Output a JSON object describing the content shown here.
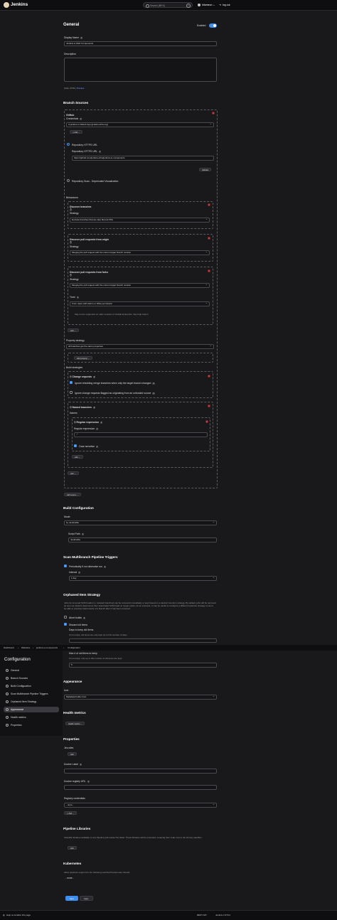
{
  "app": {
    "name": "Jenkins"
  },
  "header": {
    "search_placeholder": "Search (⌘+K)",
    "help": "?",
    "user": "hitomeun",
    "logout": "log out"
  },
  "general": {
    "title": "General",
    "enabled_label": "Enabled",
    "display_name_label": "Display Name",
    "display_name_value": "Jenkins.io Web Components",
    "description_label": "Description",
    "description_value": "",
    "format_note": "[Safe HTML]",
    "preview_link": "Preview"
  },
  "branch_sources": {
    "title": "Branch Sources",
    "github_label": "GitHub",
    "credentials_label": "Credentials",
    "credentials_value": "ci.jenkins.io GitHub App (jenkins-infra org)",
    "add_button": "Add",
    "repo_https_label": "Repository HTTPS URL",
    "repo_https_field_label": "Repository HTTPS URL",
    "repo_url_value": "https://github.com/jenkins-infra/jenkins-io-components",
    "validate_button": "Validate",
    "repo_scan_label": "Repository Scan - Deprecated Visualization",
    "behaviours_label": "Behaviours",
    "discover_branches": {
      "title": "Discover branches",
      "strategy_label": "Strategy",
      "strategy_value": "Exclude branches that are also filed as PRs"
    },
    "discover_prs_origin": {
      "title": "Discover pull requests from origin",
      "strategy_label": "Strategy",
      "strategy_value": "Merging the pull request with the current target branch revision"
    },
    "discover_prs_forks": {
      "title": "Discover pull requests from forks",
      "strategy_label": "Strategy",
      "strategy_value": "Merging the pull request with the current target branch revision",
      "trust_label": "Trust",
      "trust_value": "From users with Admin or Write permission",
      "trust_note": "May not be supported on older versions of GitHub Enterprise. See help button."
    },
    "add_behaviour_button": "Add",
    "property_strategy_label": "Property strategy",
    "property_strategy_value": "All branches get the same properties",
    "add_property_button": "Add property",
    "build_strategies_label": "Build strategies",
    "change_requests": {
      "title": "Change requests",
      "opt1": "Ignore rebuilding merge branches when only the target branch changed",
      "opt2": "Ignore change requests flagged as originating from an untrusted source"
    },
    "named_branches": {
      "title": "Named branches",
      "names_label": "Names",
      "regex_title": "Regular expression",
      "regex_label": "Regular expression",
      "regex_value": ".*",
      "case_sensitive": "Case sensitive",
      "add_inner": "Add",
      "add_outer": "Add"
    },
    "add_strategy_button": "Add",
    "add_source_button": "Add source"
  },
  "build_configuration": {
    "title": "Build Configuration",
    "mode_label": "Mode",
    "mode_value": "by Jenkinsfile",
    "script_path_label": "Script Path",
    "script_path_value": "Jenkinsfile"
  },
  "scan_triggers": {
    "title": "Scan Multibranch Pipeline Triggers",
    "periodic_label": "Periodically if not otherwise run",
    "interval_label": "Interval",
    "interval_value": "1 day"
  },
  "orphaned": {
    "title": "Orphaned Item Strategy",
    "description": "Jobs for removed SCM heads (i.e. deleted branches) can be removed immediately or kept based on a desired retention strategy. By default, jobs will be removed as soon as Jenkins determines their associated SCM head no longer exists. As an example, it may be useful to configure a different retention strategy so as to be able to examine build results of a branch after it has been removed.",
    "abort_builds": "Abort builds",
    "discard_old": "Discard old items",
    "days_label": "Days to keep old items",
    "days_hint": "If not empty, old items are only kept up to this number of days",
    "max_label": "Max # of old items to keep",
    "max_hint": "If not empty, only up to this number of old items are kept",
    "max_value": "5"
  },
  "breadcrumbs": [
    "Dashboard",
    "Websites",
    "jenkins-io-components",
    "Configuration"
  ],
  "sidebar": {
    "title": "Configuration",
    "items": [
      {
        "label": "General",
        "icon": "gear-icon"
      },
      {
        "label": "Branch Sources",
        "icon": "branch-icon"
      },
      {
        "label": "Build Configuration",
        "icon": "build-icon"
      },
      {
        "label": "Scan Multibranch Pipeline Triggers",
        "icon": "clock-icon"
      },
      {
        "label": "Orphaned Item Strategy",
        "icon": "trash-icon"
      },
      {
        "label": "Appearance",
        "icon": "eye-icon"
      },
      {
        "label": "Health metrics",
        "icon": "heart-icon"
      },
      {
        "label": "Properties",
        "icon": "list-icon"
      }
    ],
    "active_index": 5
  },
  "appearance": {
    "title": "Appearance",
    "icon_label": "Icon",
    "icon_value": "Metadata Folder Icon"
  },
  "health": {
    "title": "Health metrics",
    "button": "Health metrics ⌄"
  },
  "properties": {
    "title": "Properties",
    "jira_label": "Jira sites",
    "jira_add": "Add",
    "docker_label_label": "Docker Label",
    "docker_registry_label": "Docker registry URL",
    "registry_credentials_label": "Registry credentials",
    "registry_credentials_value": "- none -",
    "registry_add": "Add"
  },
  "pipeline_libraries": {
    "title": "Pipeline Libraries",
    "description": "Sharable libraries available to any Pipeline jobs inside this folder. These libraries will be untrusted, meaning their code runs in the Groovy sandbox.",
    "add": "Add"
  },
  "kubernetes": {
    "title": "Kubernetes",
    "description": "Allow pipelines support for the following restricted Kubernetes Clouds:",
    "value": "- none -"
  },
  "actions": {
    "save": "Save",
    "apply": "Apply"
  },
  "footer": {
    "help": "Help us localize this page",
    "rest_api": "REST API",
    "version": "Jenkins 2.370.2"
  },
  "colors": {
    "accent": "#3d8ef0",
    "danger": "#8b1f1f",
    "background": "#19191c"
  }
}
